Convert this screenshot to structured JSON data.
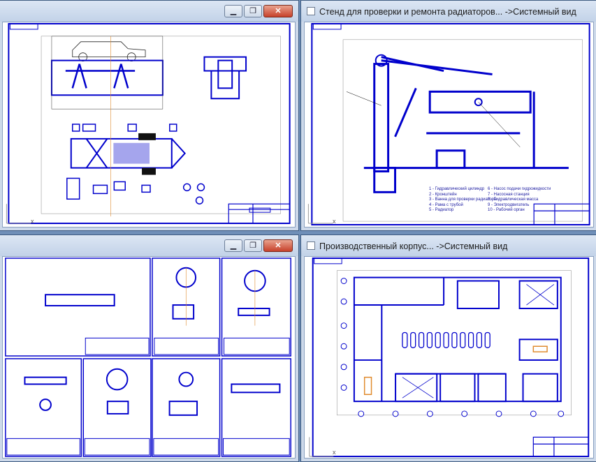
{
  "windows": {
    "top_left": {
      "title": "",
      "controls": {
        "minimize": "▁",
        "maximize": "❐",
        "close": "✕"
      }
    },
    "top_right": {
      "title": "Стенд для проверки и ремонта радиаторов... ->Системный вид"
    },
    "bottom_left": {
      "title": "",
      "controls": {
        "minimize": "▁",
        "maximize": "❐",
        "close": "✕"
      }
    },
    "bottom_right": {
      "title": "Производственный корпус... ->Системный вид"
    }
  },
  "stand_legend": {
    "col1": [
      "1 - Гидравлический цилиндр",
      "2 - Кронштейн",
      "3 - Ванна для проверки радиатора",
      "4 - Рама с трубой",
      "5 - Радиатор"
    ],
    "col2": [
      "6 - Насос подачи гидрожидкости",
      "7 - Насосная станция",
      "8 - Гидравлическая масса",
      "9 - Электродвигатель",
      "10 - Рабочий орган"
    ]
  },
  "coord_axis_label": "x",
  "icons": [
    "app-document-icon",
    "minimize-icon",
    "maximize-icon",
    "close-icon"
  ],
  "colors": {
    "drawing_blue": "#0000cc",
    "frame": "#3d5a80",
    "accent_orange": "#e08a2c"
  }
}
